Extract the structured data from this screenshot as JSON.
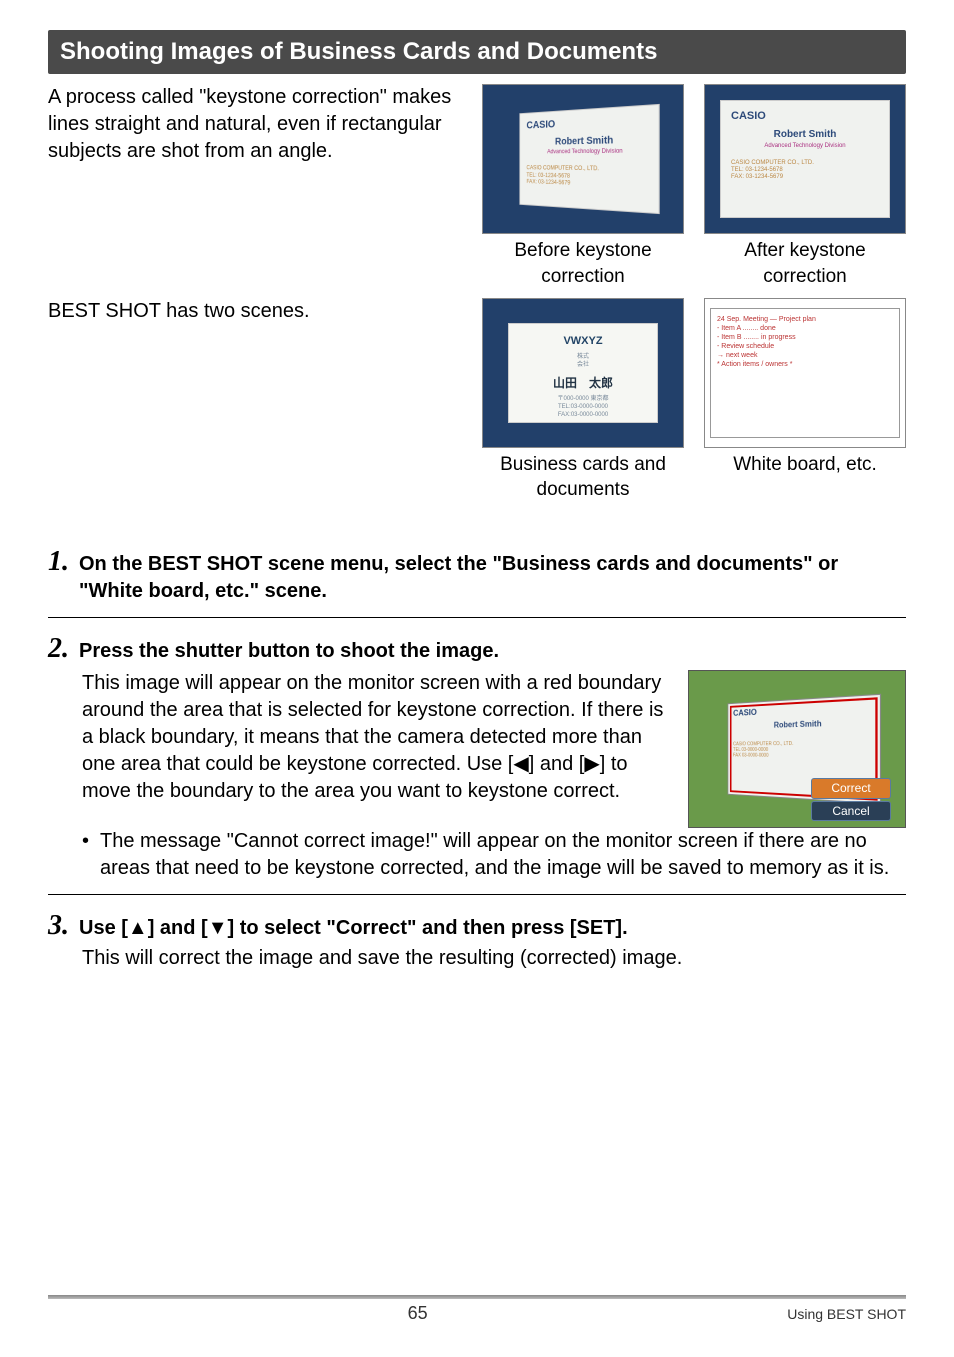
{
  "section_title": "Shooting Images of Business Cards and Documents",
  "intro": "A process called \"keystone correction\" makes lines straight and natural, even if rectangular subjects are shot from an angle.",
  "best_shot_line": "BEST SHOT has two scenes.",
  "figs": {
    "before": {
      "caption": "Before keystone correction",
      "brand": "CASIO",
      "name": "Robert Smith"
    },
    "after": {
      "caption": "After keystone correction",
      "brand": "CASIO",
      "name": "Robert Smith"
    },
    "bizcard": {
      "caption": "Business cards and documents",
      "logo": "VWXYZ",
      "name_jp": "山田　太郎"
    },
    "whiteboard": {
      "caption": "White board, etc."
    }
  },
  "steps": [
    {
      "num": "1.",
      "title": "On the BEST SHOT scene menu, select the \"Business cards and documents\" or \"White board, etc.\" scene."
    },
    {
      "num": "2.",
      "title": "Press the shutter button to shoot the image.",
      "body": "This image will appear on the monitor screen with a red boundary around the area that is selected for keystone correction. If there is a black boundary, it means that the camera detected more than one area that could be keystone corrected. Use [◀] and [▶] to move the boundary to the area you want to keystone correct.",
      "bullet": "The message \"Cannot correct image!\" will appear on the monitor screen if there are no areas that need to be keystone corrected, and the image will be saved to memory as it is.",
      "monitor": {
        "brand": "CASIO",
        "name": "Robert Smith",
        "btn_correct": "Correct",
        "btn_cancel": "Cancel"
      }
    },
    {
      "num": "3.",
      "title": "Use [▲] and [▼] to select \"Correct\" and then press [SET].",
      "body": "This will correct the image and save the resulting (corrected) image."
    }
  ],
  "footer": {
    "page": "65",
    "section": "Using BEST SHOT"
  }
}
